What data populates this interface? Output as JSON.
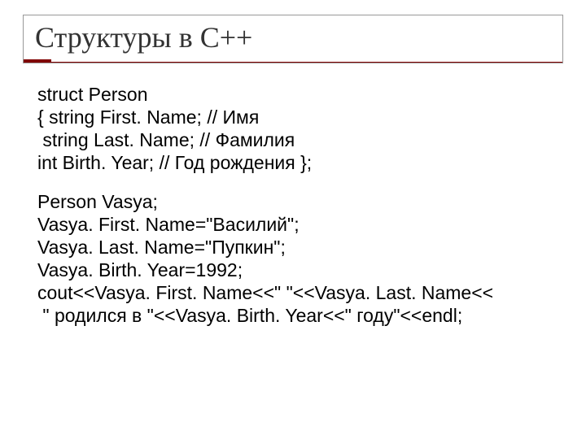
{
  "title": "Структуры в С++",
  "block1": {
    "l1": "struct Person",
    "l2": "{ string First. Name; // Имя",
    "l3": " string Last. Name; // Фамилия",
    "l4": "int Birth. Year; // Год рождения };"
  },
  "block2": {
    "l1": "Person Vasya;",
    "l2": "Vasya. First. Name=\"Василий\";",
    "l3": "Vasya. Last. Name=\"Пупкин\";",
    "l4": "Vasya. Birth. Year=1992;",
    "l5": "cout<<Vasya. First. Name<<\" \"<<Vasya. Last. Name<<",
    "l6": " \" родился в \"<<Vasya. Birth. Year<<\" году\"<<endl;"
  }
}
